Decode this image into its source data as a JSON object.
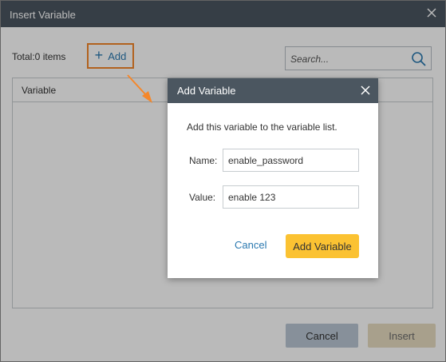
{
  "outer_dialog": {
    "title": "Insert Variable",
    "total_label": "Total:0 items",
    "add_label": "Add",
    "search_placeholder": "Search...",
    "table": {
      "columns": [
        "Variable"
      ]
    },
    "cancel_label": "Cancel",
    "insert_label": "Insert"
  },
  "modal": {
    "title": "Add Variable",
    "description": "Add this variable to the variable list.",
    "name_label": "Name:",
    "name_value": "enable_password",
    "value_label": "Value:",
    "value_value": "enable 123",
    "cancel_label": "Cancel",
    "add_label": "Add Variable"
  },
  "colors": {
    "titlebar": "#4b5660",
    "highlight": "#f5872a",
    "link": "#2b79b0",
    "primary_button": "#fbc232"
  }
}
